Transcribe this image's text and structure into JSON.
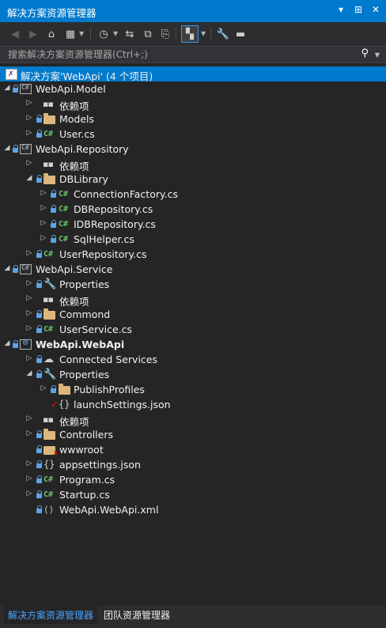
{
  "window": {
    "title": "解决方案资源管理器"
  },
  "title_buttons": [
    "▾",
    "⊞",
    "✕"
  ],
  "search": {
    "placeholder": "搜索解决方案资源管理器(Ctrl+;)"
  },
  "tree": [
    {
      "label": "解决方案'WebApi' (4 个项目)",
      "icon": "solution-icon",
      "selected": true
    },
    {
      "label": "WebApi.Model",
      "icon": "csharp-project-icon",
      "expanded": true
    },
    {
      "label": "依赖项",
      "icon": "dependencies-icon",
      "expanded": false
    },
    {
      "label": "Models",
      "icon": "folder-icon",
      "expanded": false
    },
    {
      "label": "User.cs",
      "icon": "csharp-file-icon",
      "expanded": false
    },
    {
      "label": "WebApi.Repository",
      "icon": "csharp-project-icon",
      "expanded": true
    },
    {
      "label": "依赖项",
      "icon": "dependencies-icon",
      "expanded": false
    },
    {
      "label": "DBLibrary",
      "icon": "folder-icon",
      "expanded": true
    },
    {
      "label": "ConnectionFactory.cs",
      "icon": "csharp-file-icon",
      "expanded": false
    },
    {
      "label": "DBRepository.cs",
      "icon": "csharp-file-icon",
      "expanded": false
    },
    {
      "label": "IDBRepository.cs",
      "icon": "csharp-file-icon",
      "expanded": false
    },
    {
      "label": "SqlHelper.cs",
      "icon": "csharp-file-icon",
      "expanded": false
    },
    {
      "label": "UserRepository.cs",
      "icon": "csharp-file-icon",
      "expanded": false
    },
    {
      "label": "WebApi.Service",
      "icon": "csharp-project-icon",
      "expanded": true
    },
    {
      "label": "Properties",
      "icon": "wrench-icon",
      "expanded": false
    },
    {
      "label": "依赖项",
      "icon": "dependencies-icon",
      "expanded": false
    },
    {
      "label": "Commond",
      "icon": "folder-icon",
      "expanded": false
    },
    {
      "label": "UserService.cs",
      "icon": "csharp-file-icon",
      "expanded": false
    },
    {
      "label": "WebApi.WebApi",
      "icon": "web-project-icon",
      "expanded": true
    },
    {
      "label": "Connected Services",
      "icon": "cloud-icon",
      "expanded": false
    },
    {
      "label": "Properties",
      "icon": "wrench-icon",
      "expanded": true
    },
    {
      "label": "PublishProfiles",
      "icon": "folder-icon",
      "expanded": false
    },
    {
      "label": "launchSettings.json",
      "icon": "json-file-icon"
    },
    {
      "label": "依赖项",
      "icon": "dependencies-icon",
      "expanded": false
    },
    {
      "label": "Controllers",
      "icon": "folder-icon",
      "expanded": false
    },
    {
      "label": "wwwroot",
      "icon": "wwwroot-folder-icon"
    },
    {
      "label": "appsettings.json",
      "icon": "json-file-icon",
      "expanded": false
    },
    {
      "label": "Program.cs",
      "icon": "csharp-file-icon",
      "expanded": false
    },
    {
      "label": "Startup.cs",
      "icon": "csharp-file-icon",
      "expanded": false
    },
    {
      "label": "WebApi.WebApi.xml",
      "icon": "xml-file-icon"
    }
  ],
  "bottom_tabs": [
    "解决方案资源管理器",
    "团队资源管理器"
  ]
}
